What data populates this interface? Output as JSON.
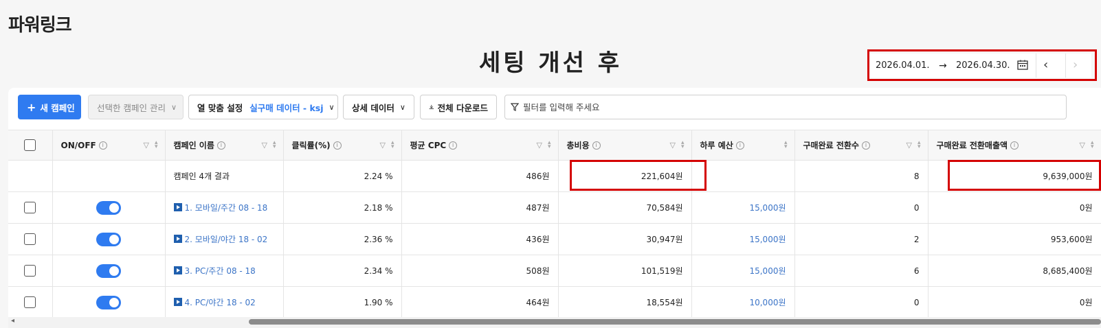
{
  "app_title": "파워링크",
  "slide_title": "세팅 개선 후",
  "date_range": {
    "start": "2026.04.01.",
    "arrow": "→",
    "end": "2026.04.30."
  },
  "toolbar": {
    "new_campaign": "새 캠페인",
    "manage_selected": "선택한 캠페인 관리",
    "column_setting_label": "열 맞춤 설정",
    "column_setting_value": "실구매 데이터 - ksj",
    "detail_data": "상세 데이터",
    "download_all": "전체 다운로드",
    "filter_placeholder": "필터를 입력해 주세요"
  },
  "table": {
    "headers": {
      "onoff": "ON/OFF",
      "name": "캠페인 이름",
      "ctr": "클릭률(%)",
      "cpc": "평균 CPC",
      "cost": "총비용",
      "budget": "하루 예산",
      "conv": "구매완료 전환수",
      "revenue": "구매완료 전환매출액"
    },
    "summary": {
      "name": "캠페인 4개 결과",
      "ctr": "2.24 %",
      "cpc": "486원",
      "cost": "221,604원",
      "budget": "",
      "conv": "8",
      "revenue": "9,639,000원"
    },
    "rows": [
      {
        "name": "1. 모바일/주간 08 - 18",
        "ctr": "2.18 %",
        "cpc": "487원",
        "cost": "70,584원",
        "budget": "15,000원",
        "conv": "0",
        "revenue": "0원"
      },
      {
        "name": "2. 모바일/야간 18 - 02",
        "ctr": "2.36 %",
        "cpc": "436원",
        "cost": "30,947원",
        "budget": "15,000원",
        "conv": "2",
        "revenue": "953,600원"
      },
      {
        "name": "3. PC/주간 08 - 18",
        "ctr": "2.34 %",
        "cpc": "508원",
        "cost": "101,519원",
        "budget": "15,000원",
        "conv": "6",
        "revenue": "8,685,400원"
      },
      {
        "name": "4. PC/야간 18 - 02",
        "ctr": "1.90 %",
        "cpc": "464원",
        "cost": "18,554원",
        "budget": "10,000원",
        "conv": "0",
        "revenue": "0원"
      }
    ]
  },
  "colors": {
    "primary": "#2f7bf0",
    "highlight_box": "#d40000",
    "link": "#3b74c7"
  }
}
